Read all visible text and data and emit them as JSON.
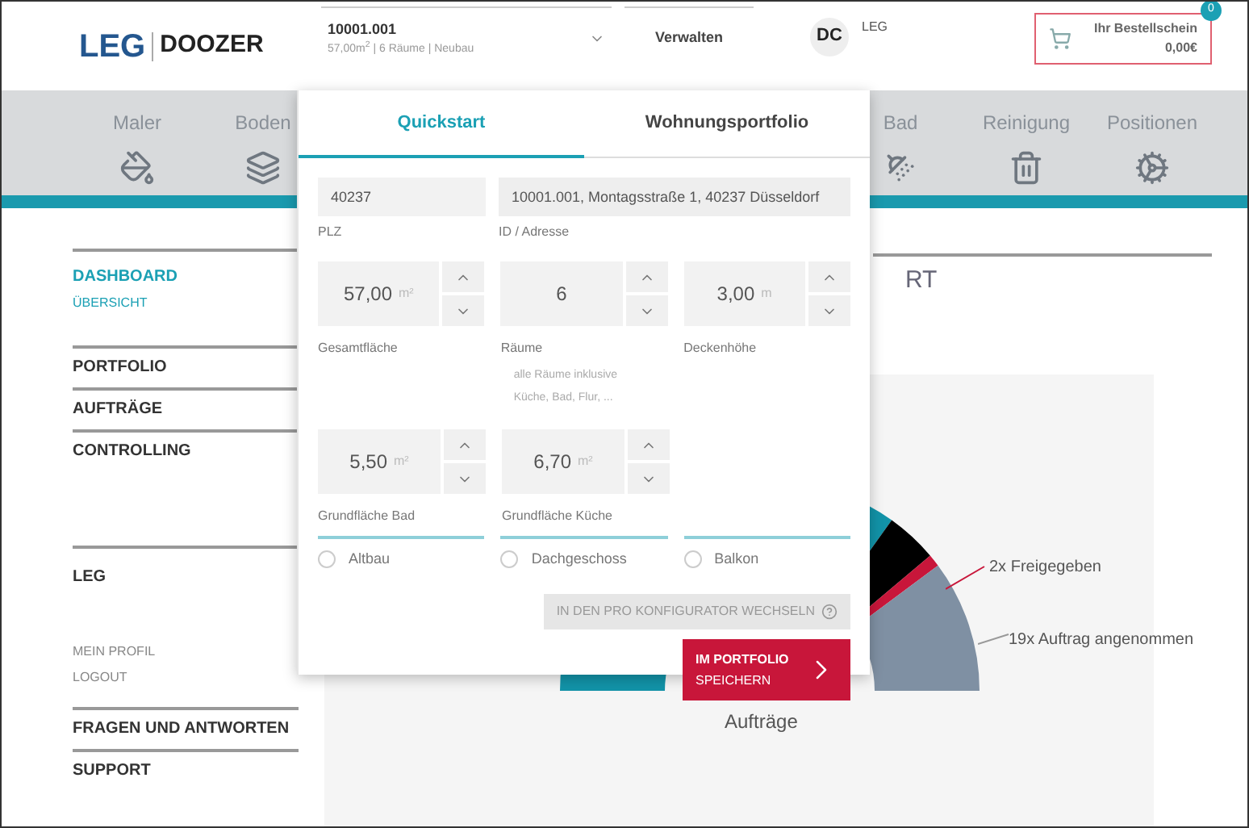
{
  "header": {
    "logo_left": "LEG",
    "logo_right": "DOOZER",
    "property": {
      "id": "10001.001",
      "summary": "57,00m$^{2}$ | 6 Räume | Neubau"
    },
    "manage": "Verwalten",
    "account": {
      "badge": "DC",
      "name": "LEG"
    },
    "cart": {
      "title": "Ihr Bestellschein",
      "total": "0,00€",
      "count": "0"
    }
  },
  "nav": {
    "left_items": [
      {
        "label": "Maler"
      },
      {
        "label": "Boden"
      }
    ],
    "right_items": [
      {
        "label": "Bad"
      },
      {
        "label": "Reinigung"
      },
      {
        "label": "Positionen"
      }
    ]
  },
  "sidebar": {
    "groups": [
      {
        "items": [
          {
            "label": "DASHBOARD",
            "selected": true,
            "kind": "main"
          },
          {
            "label": "ÜBERSICHT",
            "selected": true,
            "kind": "sub"
          }
        ]
      },
      {
        "items": [
          {
            "label": "PORTFOLIO",
            "selected": false,
            "kind": "main"
          }
        ]
      },
      {
        "items": [
          {
            "label": "AUFTRÄGE",
            "selected": false,
            "kind": "main"
          }
        ]
      },
      {
        "items": [
          {
            "label": "CONTROLLING",
            "selected": false,
            "kind": "main"
          }
        ]
      },
      {
        "items": [
          {
            "label": "LEG",
            "selected": false,
            "kind": "main"
          }
        ]
      },
      {
        "items": [
          {
            "label": "MEIN PROFIL",
            "selected": false,
            "kind": "sub"
          },
          {
            "label": "LOGOUT",
            "selected": false,
            "kind": "sub"
          }
        ]
      },
      {
        "items": [
          {
            "label": "FRAGEN UND ANTWORTEN",
            "selected": false,
            "kind": "main"
          }
        ]
      },
      {
        "items": [
          {
            "label": "SUPPORT",
            "selected": false,
            "kind": "main"
          }
        ]
      }
    ]
  },
  "main": {
    "title": "RT",
    "chart_labels": [
      "2x Freigegeben",
      "19x Auftrag angenommen"
    ],
    "chart_caption": "Aufträge"
  },
  "popup": {
    "tabs": [
      {
        "label": "Quickstart",
        "selected": true
      },
      {
        "label": "Wohnungsportfolio",
        "selected": false
      }
    ],
    "plz": {
      "value": "40237",
      "label": "PLZ"
    },
    "address": {
      "value": "10001.001, Montagsstraße 1, 40237 Düsseldorf",
      "label": "ID / Adresse"
    },
    "spinner_rows": [
      [
        {
          "value": "57,00",
          "unit": "m²",
          "label": "Gesamtfläche"
        },
        {
          "value": "6",
          "label": "Räume",
          "hint": "alle Räume inklusive Küche, Bad, Flur, ..."
        },
        {
          "value": "3,00",
          "unit": "m",
          "label": "Deckenhöhe"
        }
      ],
      [
        {
          "value": "5,50",
          "unit": "m²",
          "label": "Grundfläche Bad"
        },
        {
          "value": "6,70",
          "unit": "m²",
          "label": "Grundfläche Küche"
        }
      ]
    ],
    "options": [
      {
        "label": "Altbau",
        "checked": false
      },
      {
        "label": "Dachgeschoss",
        "checked": false
      },
      {
        "label": "Balkon",
        "checked": false
      }
    ],
    "pro_button": "IN DEN PRO KONFIGURATOR WECHSELN",
    "save_button": [
      "IM PORTFOLIO",
      "SPEICHERN"
    ]
  }
}
